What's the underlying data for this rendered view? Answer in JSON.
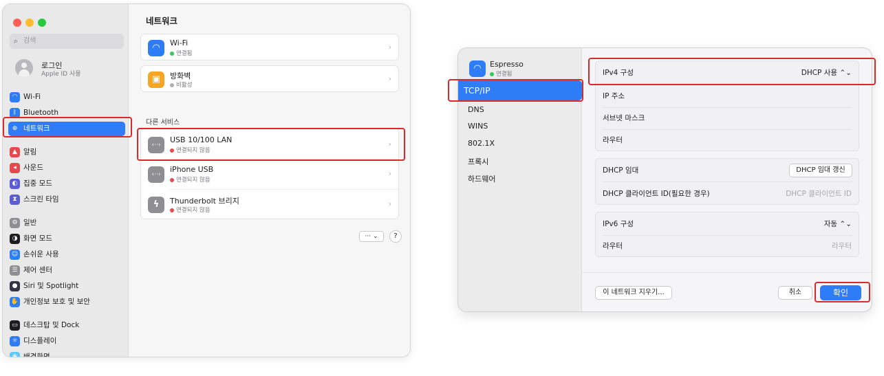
{
  "settings": {
    "search_placeholder": "검색",
    "account": {
      "name": "로그인",
      "sub": "Apple ID 사용"
    },
    "sidebar": [
      {
        "label": "Wi-Fi",
        "icon": "wifi-icon",
        "color": "#2e7cf6"
      },
      {
        "label": "Bluetooth",
        "icon": "bluetooth-icon",
        "color": "#2e7cf6"
      },
      {
        "label": "네트워크",
        "icon": "globe-icon",
        "color": "#2e7cf6",
        "active": true
      },
      {
        "label": "알림",
        "icon": "bell-icon",
        "color": "#e5484d"
      },
      {
        "label": "사운드",
        "icon": "speaker-icon",
        "color": "#e5484d"
      },
      {
        "label": "집중 모드",
        "icon": "moon-icon",
        "color": "#5b5bd6"
      },
      {
        "label": "스크린 타임",
        "icon": "hourglass-icon",
        "color": "#5b5bd6"
      },
      {
        "label": "일반",
        "icon": "gear-icon",
        "color": "#8e8e93"
      },
      {
        "label": "화면 모드",
        "icon": "appearance-icon",
        "color": "#1d1d1f"
      },
      {
        "label": "손쉬운 사용",
        "icon": "accessibility-icon",
        "color": "#2e7cf6"
      },
      {
        "label": "제어 센터",
        "icon": "control-center-icon",
        "color": "#8e8e93"
      },
      {
        "label": "Siri 및 Spotlight",
        "icon": "siri-icon",
        "color": "#333344"
      },
      {
        "label": "개인정보 보호 및 보안",
        "icon": "hand-icon",
        "color": "#2e7cf6"
      },
      {
        "label": "데스크탑 및 Dock",
        "icon": "dock-icon",
        "color": "#1d1d1f"
      },
      {
        "label": "디스플레이",
        "icon": "display-icon",
        "color": "#2e7cf6"
      },
      {
        "label": "배경화면",
        "icon": "wallpaper-icon",
        "color": "#5ac8fa"
      }
    ],
    "title": "네트워크",
    "top_services": [
      {
        "title": "Wi-Fi",
        "status": "연결됨",
        "status_color": "#34c759",
        "icon": "wifi-icon",
        "icon_color": "#2e7cf6"
      },
      {
        "title": "방화벽",
        "status": "비활성",
        "status_color": "#b0b0b4",
        "icon": "firewall-icon",
        "icon_color": "#f5a623"
      }
    ],
    "other_label": "다른 서비스",
    "other_services": [
      {
        "title": "USB 10/100 LAN",
        "status": "연결되지 않음",
        "status_color": "#e5484d",
        "icon": "ethernet-icon"
      },
      {
        "title": "iPhone USB",
        "status": "연결되지 않음",
        "status_color": "#e5484d",
        "icon": "ethernet-icon"
      },
      {
        "title": "Thunderbolt 브리지",
        "status": "연결되지 않음",
        "status_color": "#e5484d",
        "icon": "thunderbolt-icon"
      }
    ],
    "more_label": "··· ⌄",
    "help_label": "?"
  },
  "detail": {
    "service_name": "Espresso",
    "service_status": "연결됨",
    "sidebar": [
      "TCP/IP",
      "DNS",
      "WINS",
      "802.1X",
      "프록시",
      "하드웨어"
    ],
    "ipv4": {
      "label": "IPv4 구성",
      "value": "DHCP 사용 ⌃⌄"
    },
    "ip_rows": [
      {
        "label": "IP 주소",
        "value": ""
      },
      {
        "label": "서브넷 마스크",
        "value": ""
      },
      {
        "label": "라우터",
        "value": ""
      }
    ],
    "dhcp_lease": {
      "label": "DHCP 임대",
      "button": "DHCP 임대 갱신"
    },
    "dhcp_client": {
      "label": "DHCP 클라이언트 ID(필요한 경우)",
      "placeholder": "DHCP 클라이언트 ID"
    },
    "ipv6": {
      "label": "IPv6 구성",
      "value": "자동 ⌃⌄"
    },
    "ipv6_router": {
      "label": "라우터",
      "value": "라우터"
    },
    "forget_button": "이 네트워크 지우기...",
    "cancel_button": "취소",
    "ok_button": "확인"
  }
}
